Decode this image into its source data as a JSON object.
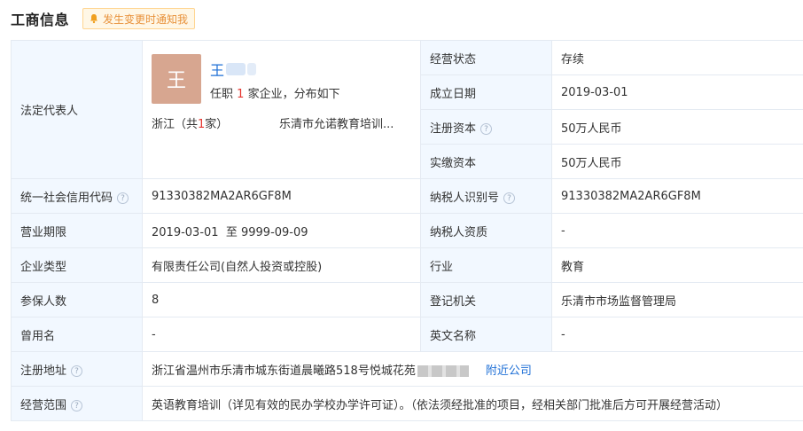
{
  "header": {
    "title": "工商信息",
    "notify_label": "发生变更时通知我"
  },
  "legal_rep": {
    "label": "法定代表人",
    "avatar_char": "王",
    "name": "王",
    "role_prefix": "任职",
    "role_count": "1",
    "role_suffix": "家企业，分布如下",
    "region_prefix": "浙江（共",
    "region_count": "1",
    "region_suffix": "家）",
    "company": "乐清市允诺教育培训..."
  },
  "right_top": [
    {
      "label": "经营状态",
      "value": "存续"
    },
    {
      "label": "成立日期",
      "value": "2019-03-01"
    },
    {
      "label": "注册资本",
      "value": "50万人民币"
    },
    {
      "label": "实缴资本",
      "value": "50万人民币"
    }
  ],
  "rows": {
    "credit_code": {
      "label": "统一社会信用代码",
      "value": "91330382MA2AR6GF8M"
    },
    "taxpayer_id": {
      "label": "纳税人识别号",
      "value": "91330382MA2AR6GF8M"
    },
    "term": {
      "label": "营业期限",
      "start": "2019-03-01",
      "sep": "至",
      "end": "9999-09-09"
    },
    "taxpayer_qual": {
      "label": "纳税人资质",
      "value": "-"
    },
    "company_type": {
      "label": "企业类型",
      "value": "有限责任公司(自然人投资或控股)"
    },
    "industry": {
      "label": "行业",
      "value": "教育"
    },
    "insured": {
      "label": "参保人数",
      "value": "8"
    },
    "authority": {
      "label": "登记机关",
      "value": "乐清市市场监督管理局"
    },
    "former_name": {
      "label": "曾用名",
      "value": "-"
    },
    "english_name": {
      "label": "英文名称",
      "value": "-"
    },
    "address": {
      "label": "注册地址",
      "value": "浙江省温州市乐清市城东街道晨曦路518号悦城花苑",
      "link": "附近公司"
    },
    "scope": {
      "label": "经营范围",
      "value": "英语教育培训（详见有效的民办学校办学许可证）。（依法须经批准的项目，经相关部门批准后方可开展经营活动）"
    }
  },
  "icons": {
    "bell": "bell-icon",
    "help": "help-circle-icon"
  },
  "colors": {
    "label_bg": "#f2f8ff",
    "border": "#e4eaf2",
    "link": "#1e6fd6",
    "notify_text": "#e8913a",
    "highlight": "#e5342e",
    "avatar_bg": "#d7a690"
  }
}
